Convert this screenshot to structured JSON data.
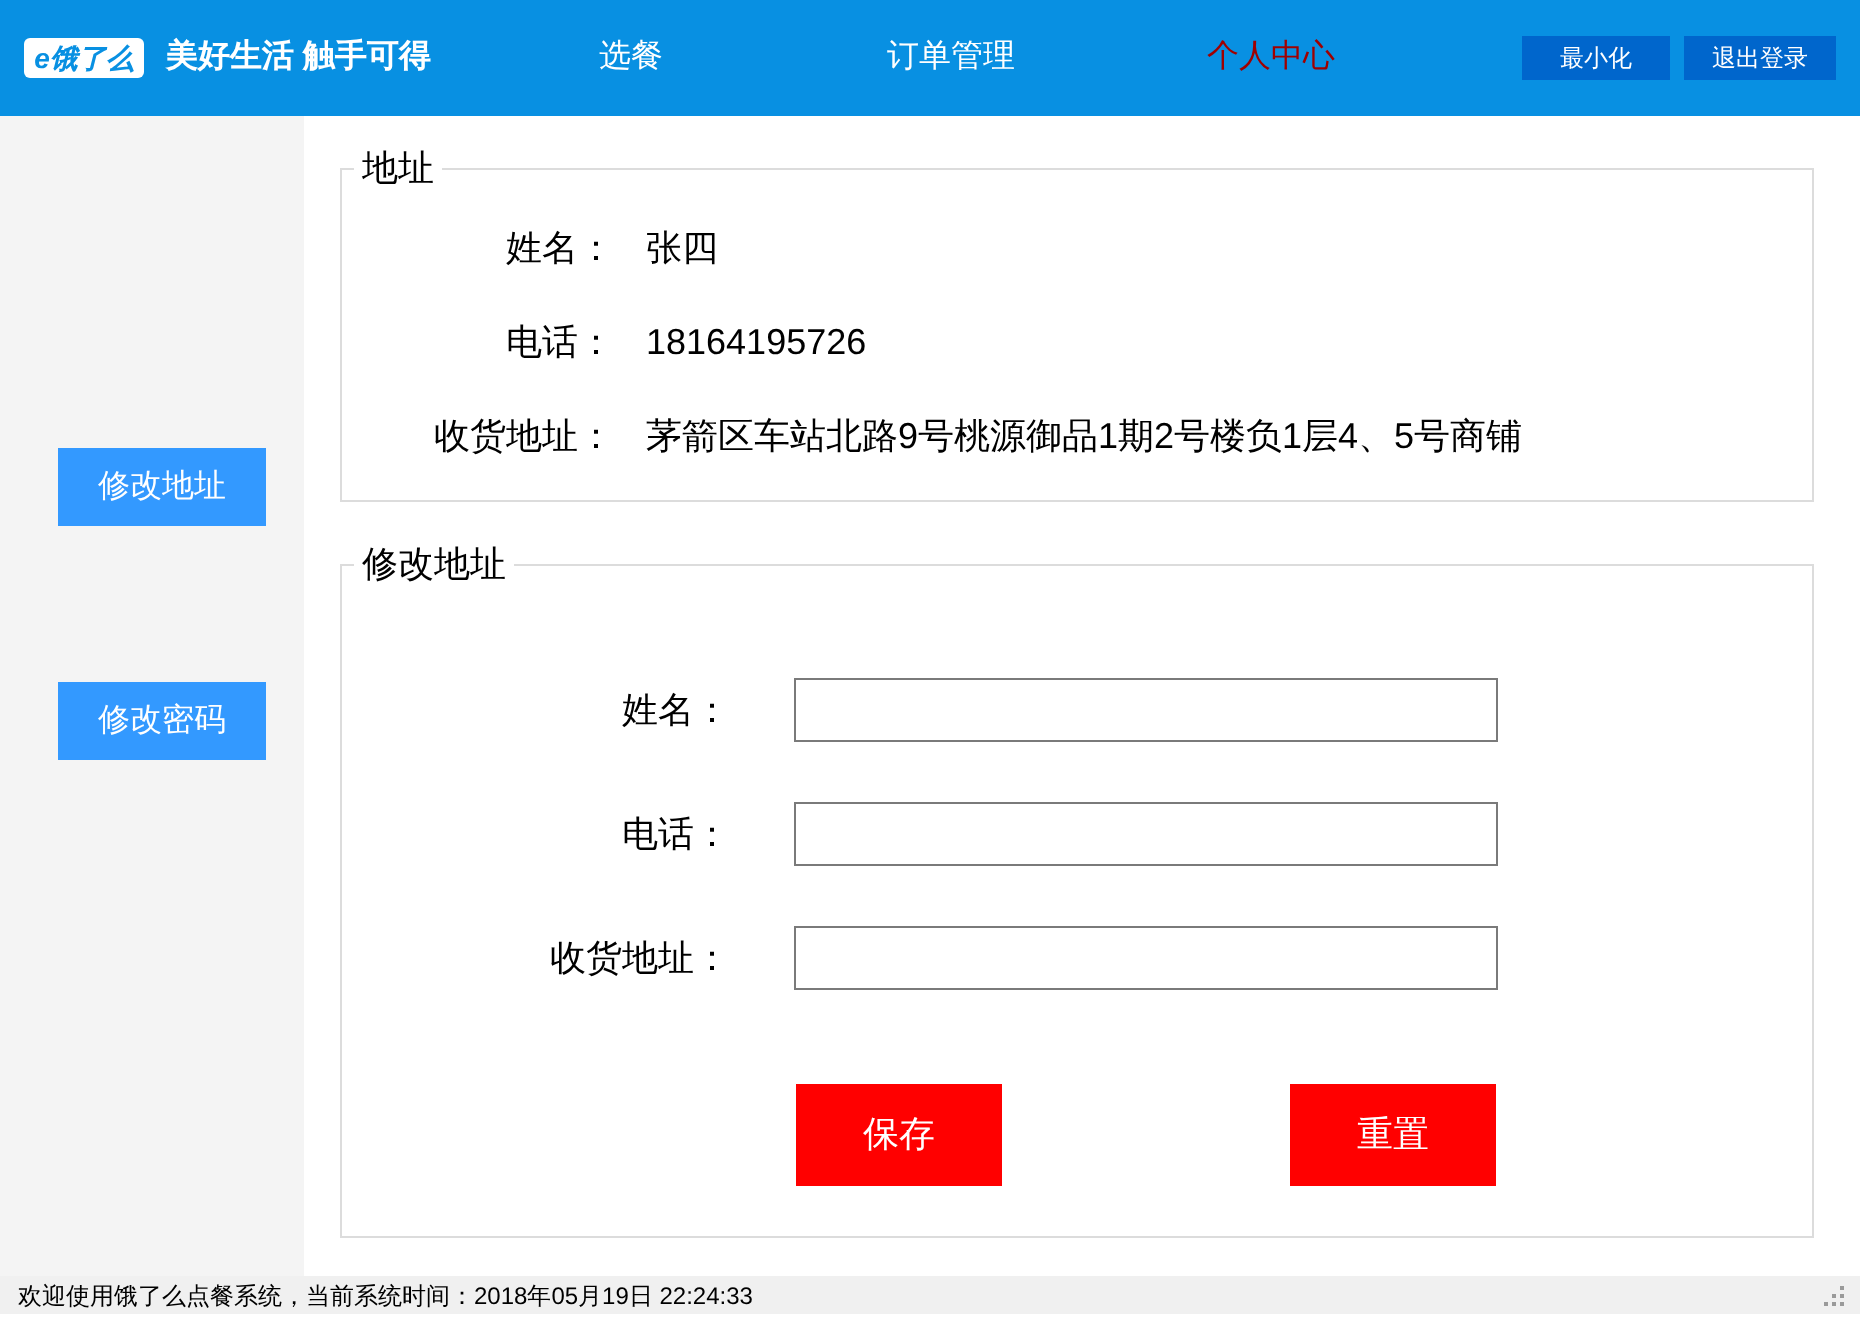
{
  "header": {
    "logo_badge": "e饿了么",
    "slogan": "美好生活 触手可得",
    "nav": [
      {
        "label": "选餐",
        "selected": false
      },
      {
        "label": "订单管理",
        "selected": false
      },
      {
        "label": "个人中心",
        "selected": true
      }
    ],
    "buttons": [
      "最小化",
      "退出登录"
    ]
  },
  "sidebar": {
    "buttons": [
      "修改地址",
      "修改密码"
    ]
  },
  "address_panel": {
    "legend": "地址",
    "fields": [
      {
        "label": "姓名：",
        "value": "张四"
      },
      {
        "label": "电话：",
        "value": "18164195726"
      },
      {
        "label": "收货地址：",
        "value": "茅箭区车站北路9号桃源御品1期2号楼负1层4、5号商铺"
      }
    ]
  },
  "edit_panel": {
    "legend": "修改地址",
    "fields": [
      {
        "label": "姓名："
      },
      {
        "label": "电话："
      },
      {
        "label": "收货地址："
      }
    ],
    "buttons": [
      "保存",
      "重置"
    ]
  },
  "status_bar": {
    "text": "欢迎使用饿了么点餐系统，当前系统时间：2018年05月19日 22:24:33"
  }
}
